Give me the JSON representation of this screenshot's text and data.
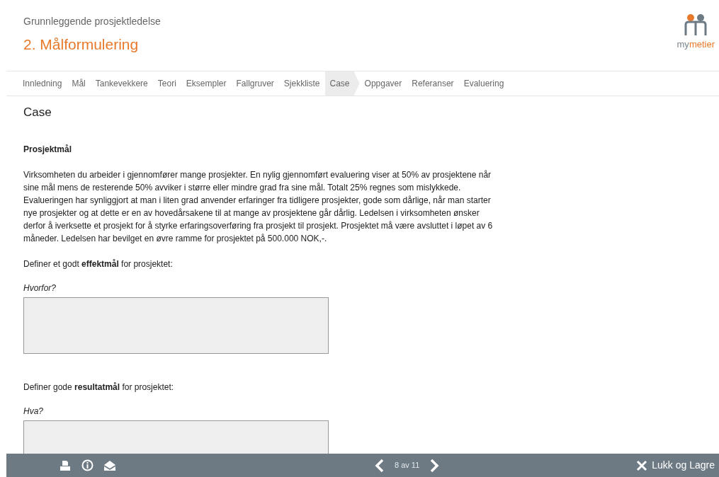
{
  "header": {
    "course": "Grunnleggende prosjektledelse",
    "title": "2. Målformulering"
  },
  "logo": {
    "part_1": "my",
    "part_2": "metier"
  },
  "tabs": [
    {
      "label": "Innledning",
      "selected": false
    },
    {
      "label": "Mål",
      "selected": false
    },
    {
      "label": "Tankevekkere",
      "selected": false
    },
    {
      "label": "Teori",
      "selected": false
    },
    {
      "label": "Eksempler",
      "selected": false
    },
    {
      "label": "Fallgruver",
      "selected": false
    },
    {
      "label": "Sjekkliste",
      "selected": false
    },
    {
      "label": "Case",
      "selected": true
    },
    {
      "label": "Oppgaver",
      "selected": false
    },
    {
      "label": "Referanser",
      "selected": false
    },
    {
      "label": "Evaluering",
      "selected": false
    }
  ],
  "section_title": "Case",
  "subheading": "Prosjektmål",
  "paragraph": "Virksomheten du arbeider i gjennomfører mange prosjekter. En nylig gjennomført evaluering viser at 50% av prosjektene når sine mål mens de resterende 50% avviker i større eller mindre grad fra sine mål. Totalt 25% regnes som mislykkede. Evalueringen har synliggjort at man i liten grad anvender erfaringer fra tidligere prosjekter, gode som dårlige, når man starter nye prosjekter og at dette er en av hovedårsakene til at mange av prosjektene går dårlig. Ledelsen i virksomheten ønsker derfor å iverksette et prosjekt for å styrke erfaringsoverføring fra prosjekt til prosjekt. Prosjektet må være avsluttet i løpet av 6 måneder. Ledelsen har bevilget en øvre ramme for prosjektet på 500.000 NOK,-.",
  "questions": [
    {
      "prompt": "Definer et godt **effektmål** for prosjektet:",
      "label": "Hvorfor?"
    },
    {
      "prompt": "Definer gode **resultatmål** for prosjektet:",
      "label": "Hva?"
    }
  ],
  "footer": {
    "page": "8 av 11",
    "close": "Lukk og Lagre"
  }
}
